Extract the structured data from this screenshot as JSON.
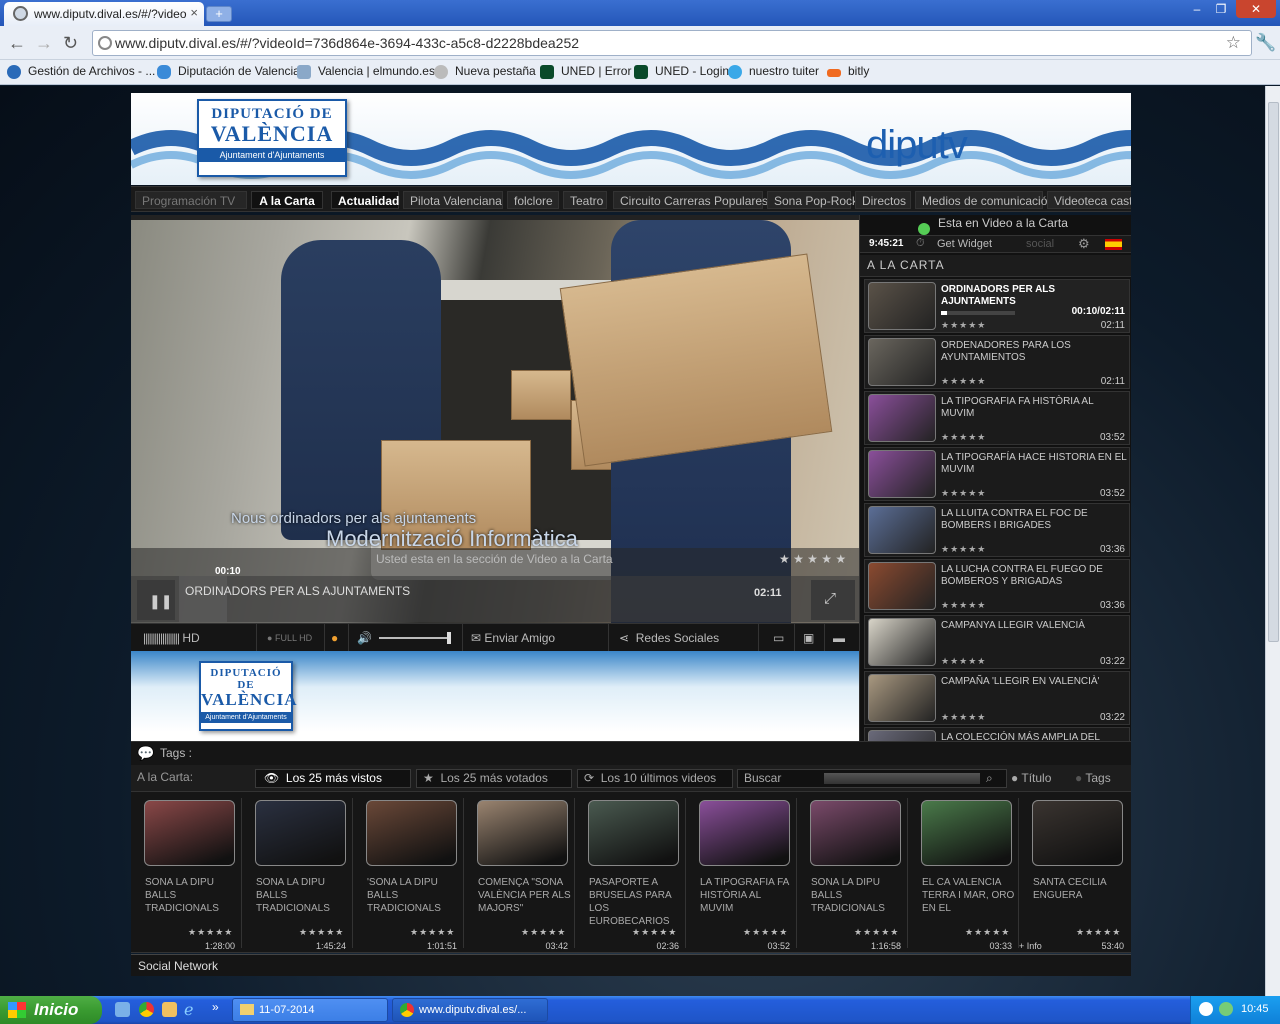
{
  "browser": {
    "tab_title": "www.diputv.dival.es/#/?video",
    "tab_close": "×",
    "new_tab": "+",
    "url": "www.diputv.dival.es/#/?videoId=736d864e-3694-433c-a5c8-d2228bdea252",
    "window_buttons": [
      "–",
      "❐",
      "✕"
    ],
    "bookmarks": [
      "Gestión de Archivos - ...",
      "Diputación de Valencia",
      "Valencia | elmundo.es",
      "Nueva pestaña",
      "UNED | Error",
      "UNED - Login",
      "nuestro tuiter",
      "bitly"
    ]
  },
  "banner": {
    "logo_line1": "DIPUTACIÓ DE",
    "logo_line2": "VALÈNCIA",
    "logo_line3": "Ajuntament d'Ajuntaments",
    "brand": "diputv"
  },
  "menu": [
    "Programación TV",
    "A la Carta",
    "Actualidad",
    "Pilota Valenciana",
    "folclore",
    "Teatro",
    "Circuito Carreras Populares",
    "Sona Pop-Rock",
    "Directos",
    "Medios de comunicación",
    "Videoteca caste"
  ],
  "player": {
    "overlay_line1": "Nous ordinadors per als ajuntaments",
    "overlay_line2": "Modernització Informàtica",
    "section_msg": "Usted esta en la sección de Video a la Carta",
    "current_time": "00:10",
    "title": "ORDINADORS PER ALS AJUNTAMENTS",
    "duration": "02:11",
    "progress": 0.076,
    "hd": "HD",
    "fullhd": "FULL HD",
    "send_friend": "Enviar Amigo",
    "social": "Redes Sociales",
    "stars": "★ ★ ★ ★ ★"
  },
  "side": {
    "status": "Esta en Video a la Carta",
    "clock": "9:45:21",
    "widget": "Get Widget",
    "social": "social",
    "section": "A LA CARTA",
    "items": [
      {
        "title": "ORDINADORS PER ALS AJUNTAMENTS",
        "time": "00:10/02:11",
        "dur": "02:11",
        "stars": "★★★★★",
        "color": "#5a5248",
        "progress": 0.076
      },
      {
        "title": "ORDENADORES PARA LOS AYUNTAMIENTOS",
        "dur": "02:11",
        "stars": "★★★★★",
        "color": "#6a665e"
      },
      {
        "title": "LA TIPOGRAFIA FA HISTÒRIA AL MUVIM",
        "dur": "03:52",
        "stars": "★★★★★",
        "color": "#8a4f9a"
      },
      {
        "title": "LA TIPOGRAFÍA HACE HISTORIA EN EL MUVIM",
        "dur": "03:52",
        "stars": "★★★★★",
        "color": "#8a4f9a"
      },
      {
        "title": "LA LLUITA CONTRA EL FOC DE BOMBERS I BRIGADES",
        "dur": "03:36",
        "stars": "★★★★★",
        "color": "#5b6e96"
      },
      {
        "title": "LA LUCHA CONTRA EL FUEGO DE BOMBEROS Y BRIGADAS",
        "dur": "03:36",
        "stars": "★★★★★",
        "color": "#8a4a30"
      },
      {
        "title": "CAMPANYA LLEGIR VALENCIÀ",
        "dur": "03:22",
        "stars": "★★★★★",
        "color": "#d8d4c8"
      },
      {
        "title": "CAMPAÑA 'LLEGIR EN VALENCIÀ'",
        "dur": "03:22",
        "stars": "★★★★★",
        "color": "#a89880"
      },
      {
        "title": "LA COLECCIÓN MÁS AMPLIA DEL REINO DE",
        "dur": "",
        "stars": "",
        "color": "#6a6a7a"
      }
    ]
  },
  "lower_logo": {
    "line1": "DIPUTACIÓ DE",
    "line2": "VALÈNCIA",
    "line3": "Ajuntament d'Ajuntaments"
  },
  "tags": {
    "label": "Tags :",
    "alacarta": "A la Carta:",
    "tab1": "Los 25 más vistos",
    "tab2": "Los 25 más votados",
    "tab3": "Los 10 últimos videos",
    "search_placeholder": "Buscar",
    "opt_title": "Título",
    "opt_tags": "Tags"
  },
  "cards": [
    {
      "title": "SONA LA DIPU BALLS TRADICIONALS",
      "dur": "1:28:00",
      "color": "#8a4848"
    },
    {
      "title": "SONA LA DIPU BALLS TRADICIONALS",
      "dur": "1:45:24",
      "color": "#2a3040"
    },
    {
      "title": "'SONA LA DIPU BALLS TRADICIONALS",
      "dur": "1:01:51",
      "color": "#6a4838"
    },
    {
      "title": "COMENÇA \"SONA VALÈNCIA PER ALS MAJORS\"",
      "dur": "03:42",
      "color": "#9a8470"
    },
    {
      "title": "PASAPORTE A BRUSELAS PARA LOS EUROBECARIOS",
      "dur": "02:36",
      "color": "#4a5a50"
    },
    {
      "title": "LA TIPOGRAFIA FA HISTÒRIA AL MUVIM",
      "dur": "03:52",
      "color": "#8a4f9a"
    },
    {
      "title": "SONA LA DIPU BALLS TRADICIONALS",
      "dur": "1:16:58",
      "color": "#7a4a6a"
    },
    {
      "title": "EL CA VALENCIA TERRA I MAR, ORO EN EL",
      "dur": "03:33",
      "color": "#4a7a4a"
    },
    {
      "title": "SANTA CECILIA ENGUERA",
      "dur": "53:40",
      "color": "#3a3430",
      "info": "+ Info"
    }
  ],
  "card_stars": "★★★★★",
  "social_network": "Social Network",
  "taskbar": {
    "start": "Inicio",
    "item1": "11-07-2014",
    "item2": "www.diputv.dival.es/...",
    "clock": "10:45",
    "quick_more": "»"
  }
}
